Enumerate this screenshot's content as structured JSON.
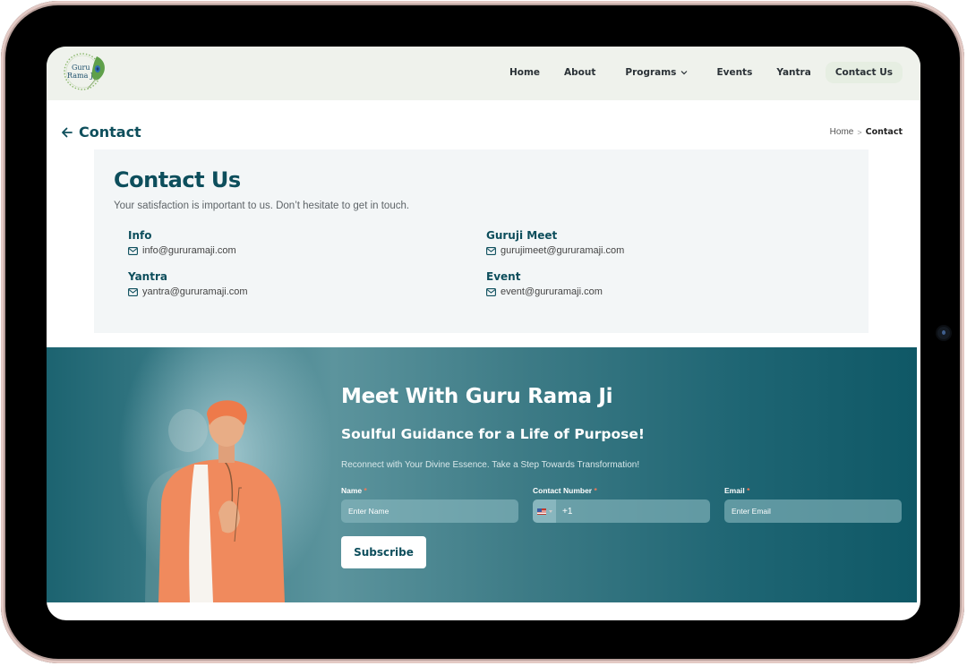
{
  "brand": {
    "logo_line1": "Guru",
    "logo_line2": "Rama Ji",
    "logo_icon": "peacock-feather-icon"
  },
  "nav": {
    "items": [
      {
        "label": "Home"
      },
      {
        "label": "About"
      },
      {
        "label": "Programs",
        "has_dropdown": true,
        "icon": "chevron-down-icon"
      },
      {
        "label": "Events"
      },
      {
        "label": "Yantra"
      },
      {
        "label": "Contact Us",
        "active": true
      }
    ]
  },
  "page_header": {
    "back_icon": "arrow-left-icon",
    "title": "Contact",
    "breadcrumb": {
      "home": "Home",
      "separator": ">",
      "current": "Contact"
    }
  },
  "contact_card": {
    "title": "Contact Us",
    "subtitle": "Your satisfaction is important to us. Don’t hesitate to get in touch.",
    "items": [
      {
        "label": "Info",
        "email": "info@gururamaji.com",
        "icon": "mail-icon"
      },
      {
        "label": "Guruji Meet",
        "email": "gurujimeet@gururamaji.com",
        "icon": "mail-icon"
      },
      {
        "label": "Yantra",
        "email": "yantra@gururamaji.com",
        "icon": "mail-icon"
      },
      {
        "label": "Event",
        "email": "event@gururamaji.com",
        "icon": "mail-icon"
      }
    ]
  },
  "hero": {
    "title": "Meet With Guru Rama Ji",
    "subtitle": "Soulful Guidance for a Life of Purpose!",
    "text": "Reconnect with Your Divine Essence. Take a Step Towards Transformation!",
    "form": {
      "name": {
        "label": "Name",
        "required_mark": "*",
        "placeholder": "Enter Name"
      },
      "phone": {
        "label": "Contact Number",
        "required_mark": "*",
        "country": "US",
        "value": "+1"
      },
      "email": {
        "label": "Email",
        "required_mark": "*",
        "placeholder": "Enter Email"
      },
      "submit_label": "Subscribe"
    }
  },
  "colors": {
    "primary": "#0d4e5c",
    "nav_bg": "#eff2ec",
    "card_bg": "#f3f6f7",
    "required": "#f07a5a"
  }
}
